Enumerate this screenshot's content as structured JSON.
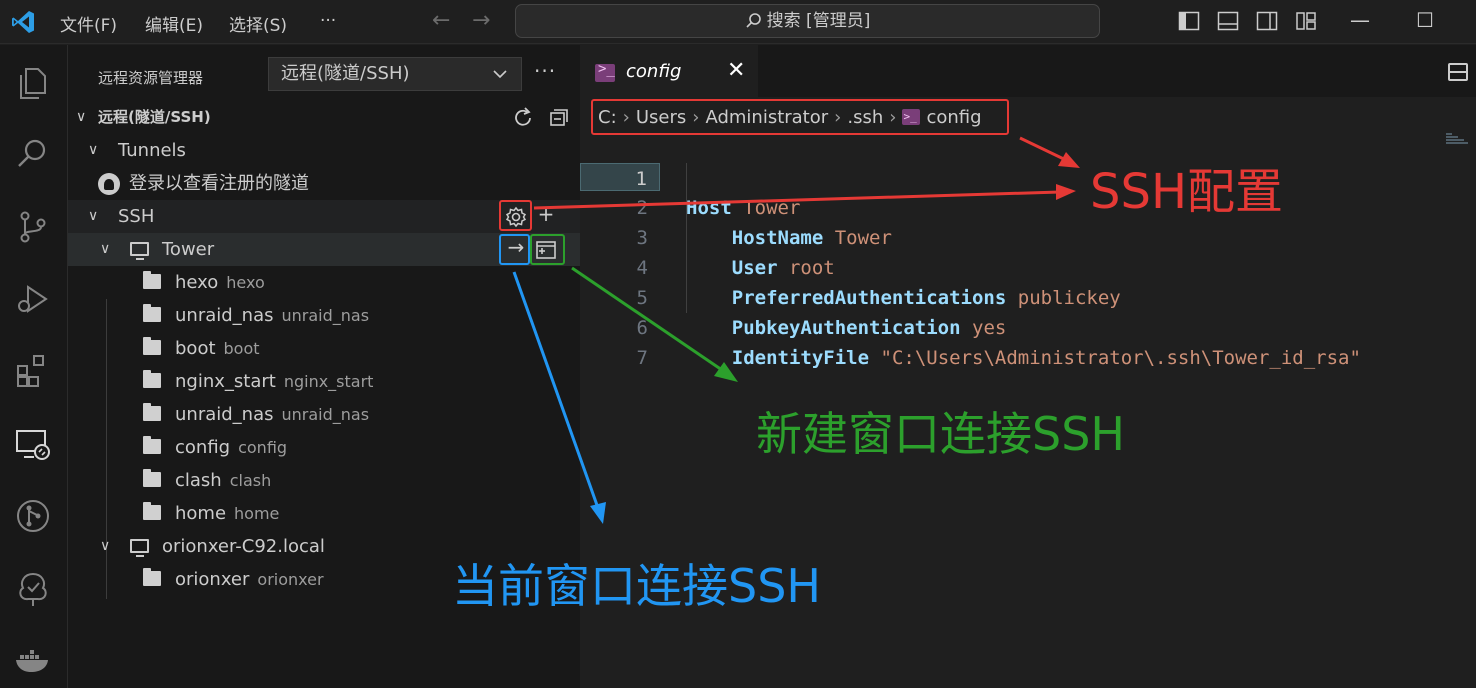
{
  "titlebar": {
    "menus": [
      "文件(F)",
      "编辑(E)",
      "选择(S)",
      "···"
    ],
    "search_label": "搜索 [管理员]",
    "minimize": "—",
    "maximize": "☐"
  },
  "sidebar": {
    "title": "远程资源管理器",
    "select_value": "远程(隧道/SSH)",
    "more": "···",
    "section_title": "远程(隧道/SSH)",
    "tunnels_label": "Tunnels",
    "tunnels_signin": "登录以查看注册的隧道",
    "ssh_label": "SSH",
    "hosts": [
      {
        "name": "Tower",
        "folders": [
          {
            "name": "hexo",
            "desc": "hexo"
          },
          {
            "name": "unraid_nas",
            "desc": "unraid_nas"
          },
          {
            "name": "boot",
            "desc": "boot"
          },
          {
            "name": "nginx_start",
            "desc": "nginx_start"
          },
          {
            "name": "unraid_nas",
            "desc": "unraid_nas"
          },
          {
            "name": "config",
            "desc": "config"
          },
          {
            "name": "clash",
            "desc": "clash"
          },
          {
            "name": "home",
            "desc": "home"
          }
        ]
      },
      {
        "name": "orionxer-C92.local",
        "folders": [
          {
            "name": "orionxer",
            "desc": "orionxer"
          }
        ]
      }
    ]
  },
  "editor": {
    "tab_name": "config",
    "tab_close": "✕",
    "breadcrumb": [
      "C:",
      "Users",
      "Administrator",
      ".ssh",
      "config"
    ],
    "lines": [
      {
        "num": "1",
        "key": "Host",
        "value": "Tower",
        "indent": ""
      },
      {
        "num": "2",
        "key": "HostName",
        "value": "Tower",
        "indent": "    "
      },
      {
        "num": "3",
        "key": "User",
        "value": "root",
        "indent": "    "
      },
      {
        "num": "4",
        "key": "PreferredAuthentications",
        "value": "publickey",
        "indent": "    "
      },
      {
        "num": "5",
        "key": "PubkeyAuthentication",
        "value": "yes",
        "indent": "    "
      },
      {
        "num": "6",
        "key": "IdentityFile",
        "value": "\"C:\\Users\\Administrator\\.ssh\\Tower_id_rsa\"",
        "indent": "    "
      },
      {
        "num": "7",
        "key": "",
        "value": "",
        "indent": ""
      }
    ]
  },
  "annotations": {
    "ssh_config": "SSH配置",
    "new_window": "新建窗口连接SSH",
    "current_window": "当前窗口连接SSH"
  },
  "colors": {
    "red": "#e53935",
    "green": "#2ca02c",
    "blue": "#2196f3",
    "accent": "#0078d4"
  }
}
